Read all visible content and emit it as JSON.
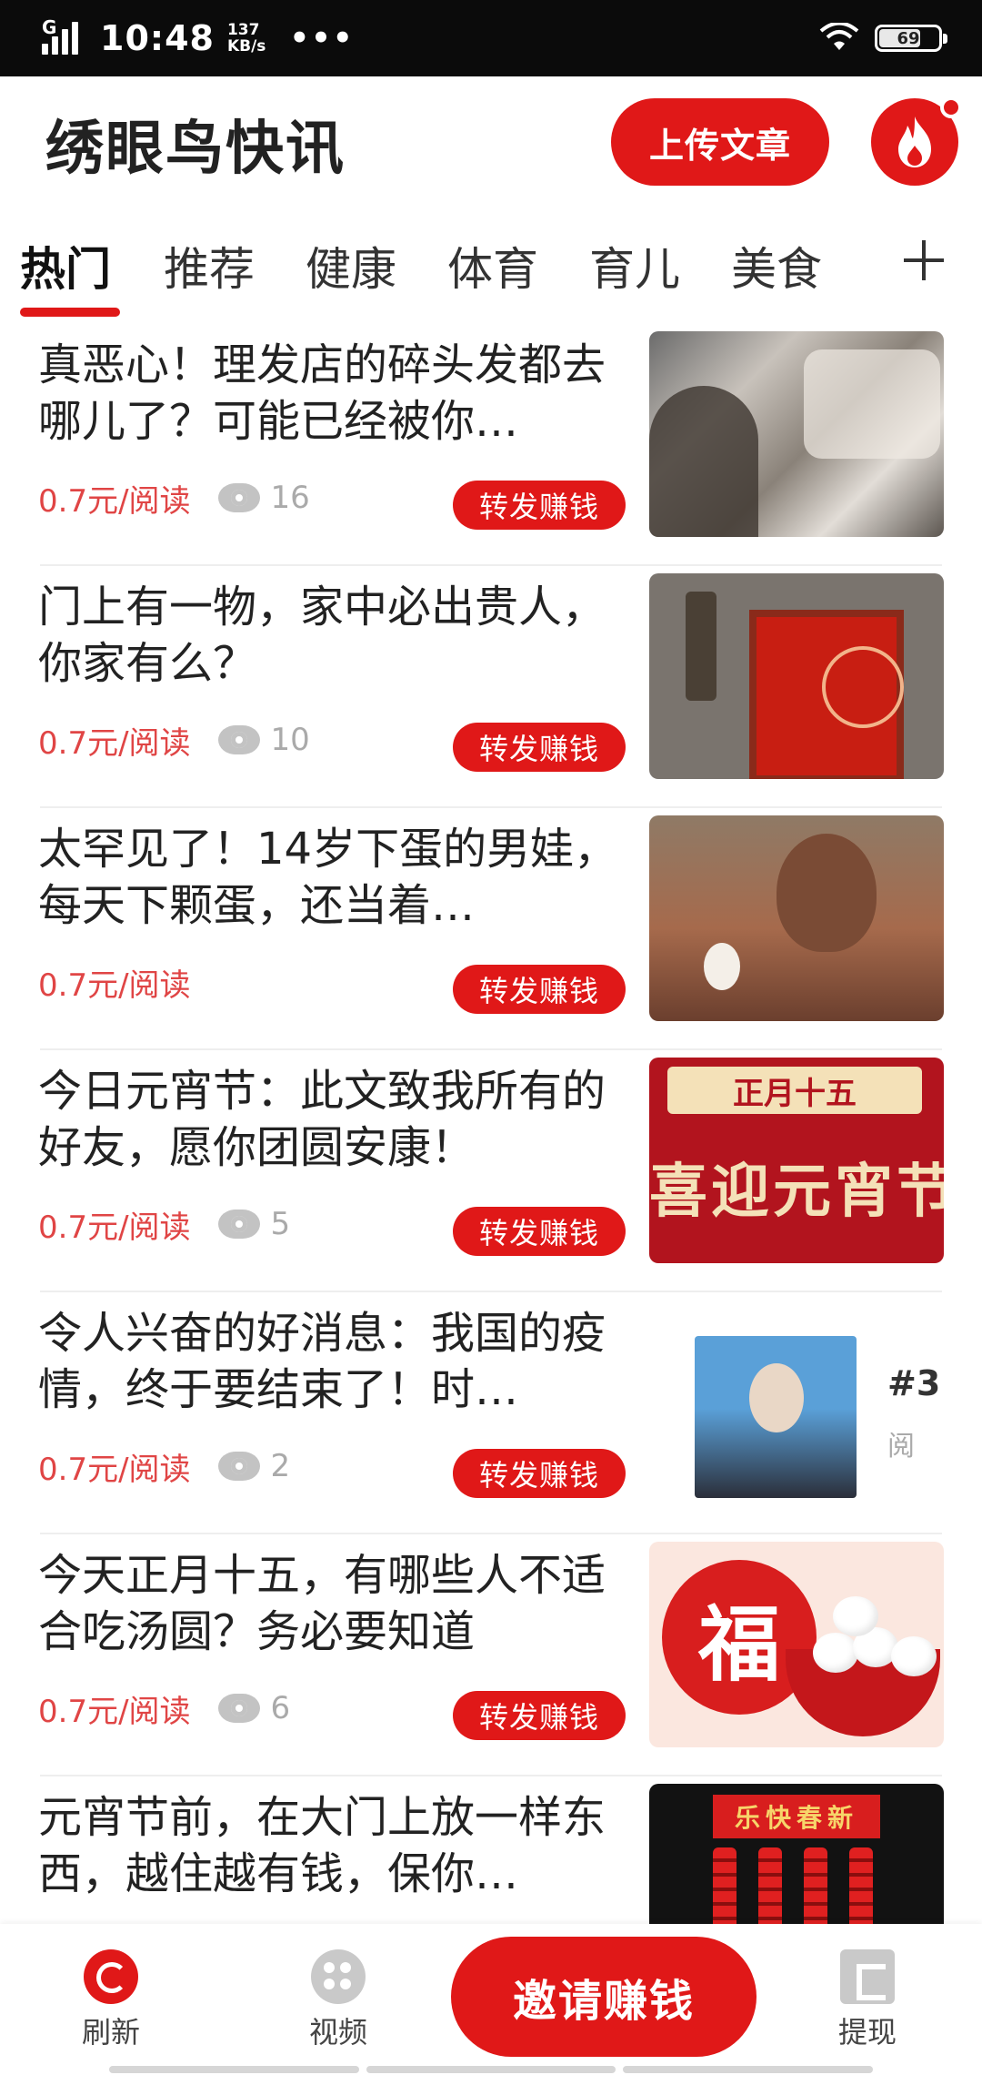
{
  "status_bar": {
    "network": "G",
    "time": "10:48",
    "speed_value": "137",
    "speed_unit": "KB/s",
    "more": "•••",
    "battery": "69"
  },
  "header": {
    "app_title": "绣眼鸟快讯",
    "upload_label": "上传文章"
  },
  "tabs": {
    "items": [
      "热门",
      "推荐",
      "健康",
      "体育",
      "育儿",
      "美食"
    ],
    "active": "热门"
  },
  "thumbnail_text": {
    "lantern_banner": "正月十五",
    "lantern_big": "喜迎元宵节",
    "news_side": "#3",
    "news_side_sub": "阅",
    "fu_char": "福",
    "spring_sign": "乐快春新"
  },
  "articles": [
    {
      "title": "真恶心！理发店的碎头发都去哪儿了？可能已经被你…",
      "price": "0.7元/阅读",
      "views": "16",
      "share_label": "转发赚钱"
    },
    {
      "title": "门上有一物，家中必出贵人，你家有么？",
      "price": "0.7元/阅读",
      "views": "10",
      "share_label": "转发赚钱"
    },
    {
      "title": "太罕见了！14岁下蛋的男娃，每天下颗蛋，还当着…",
      "price": "0.7元/阅读",
      "views": "",
      "share_label": "转发赚钱"
    },
    {
      "title": "今日元宵节：此文致我所有的好友，愿你团圆安康！",
      "price": "0.7元/阅读",
      "views": "5",
      "share_label": "转发赚钱"
    },
    {
      "title": "令人兴奋的好消息：我国的疫情，终于要结束了！时…",
      "price": "0.7元/阅读",
      "views": "2",
      "share_label": "转发赚钱"
    },
    {
      "title": "今天正月十五，有哪些人不适合吃汤圆？务必要知道",
      "price": "0.7元/阅读",
      "views": "6",
      "share_label": "转发赚钱"
    },
    {
      "title": "元宵节前，在大门上放一样东西，越住越有钱，保你…",
      "price": "",
      "views": "",
      "share_label": ""
    }
  ],
  "bottom_nav": {
    "refresh_label": "刷新",
    "video_label": "视频",
    "invite_label": "邀请赚钱",
    "withdraw_label": "提现"
  },
  "colors": {
    "accent": "#e01818",
    "price": "#e04545"
  }
}
